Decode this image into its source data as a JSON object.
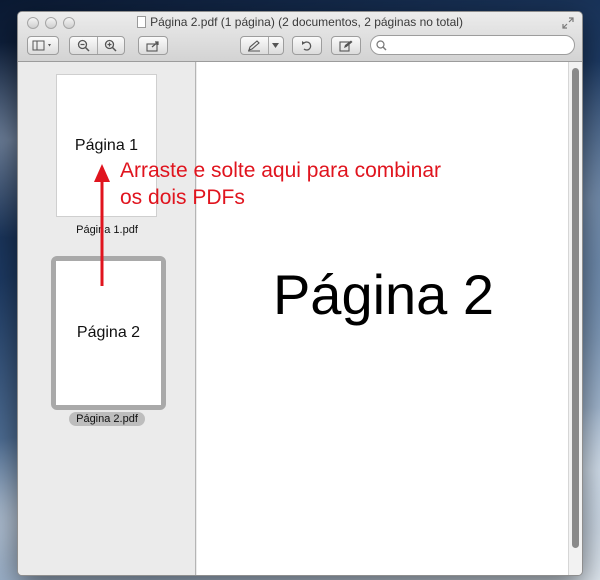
{
  "window": {
    "title": "Página 2.pdf (1 página) (2 documentos, 2 páginas no total)"
  },
  "toolbar": {
    "sidebar_toggle_icon": "sidebar-icon",
    "zoom_out_icon": "zoom-out-icon",
    "zoom_in_icon": "zoom-in-icon",
    "share_icon": "share-icon",
    "annotate_icon": "pen-icon",
    "rotate_icon": "rotate-icon",
    "edit_icon": "edit-icon",
    "search": {
      "placeholder": "",
      "value": ""
    }
  },
  "sidebar": {
    "documents": [
      {
        "page_text": "Página 1",
        "file_label": "Página 1.pdf",
        "selected": false
      },
      {
        "page_text": "Página 2",
        "file_label": "Página 2.pdf",
        "selected": true
      }
    ]
  },
  "main": {
    "page_text": "Página 2"
  },
  "annotation": {
    "text_line1": "Arraste e solte aqui para combinar",
    "text_line2": "os dois PDFs",
    "color": "#e0141e"
  },
  "colors": {
    "window_chrome": "#ececec",
    "accent_annotation": "#e0141e"
  }
}
